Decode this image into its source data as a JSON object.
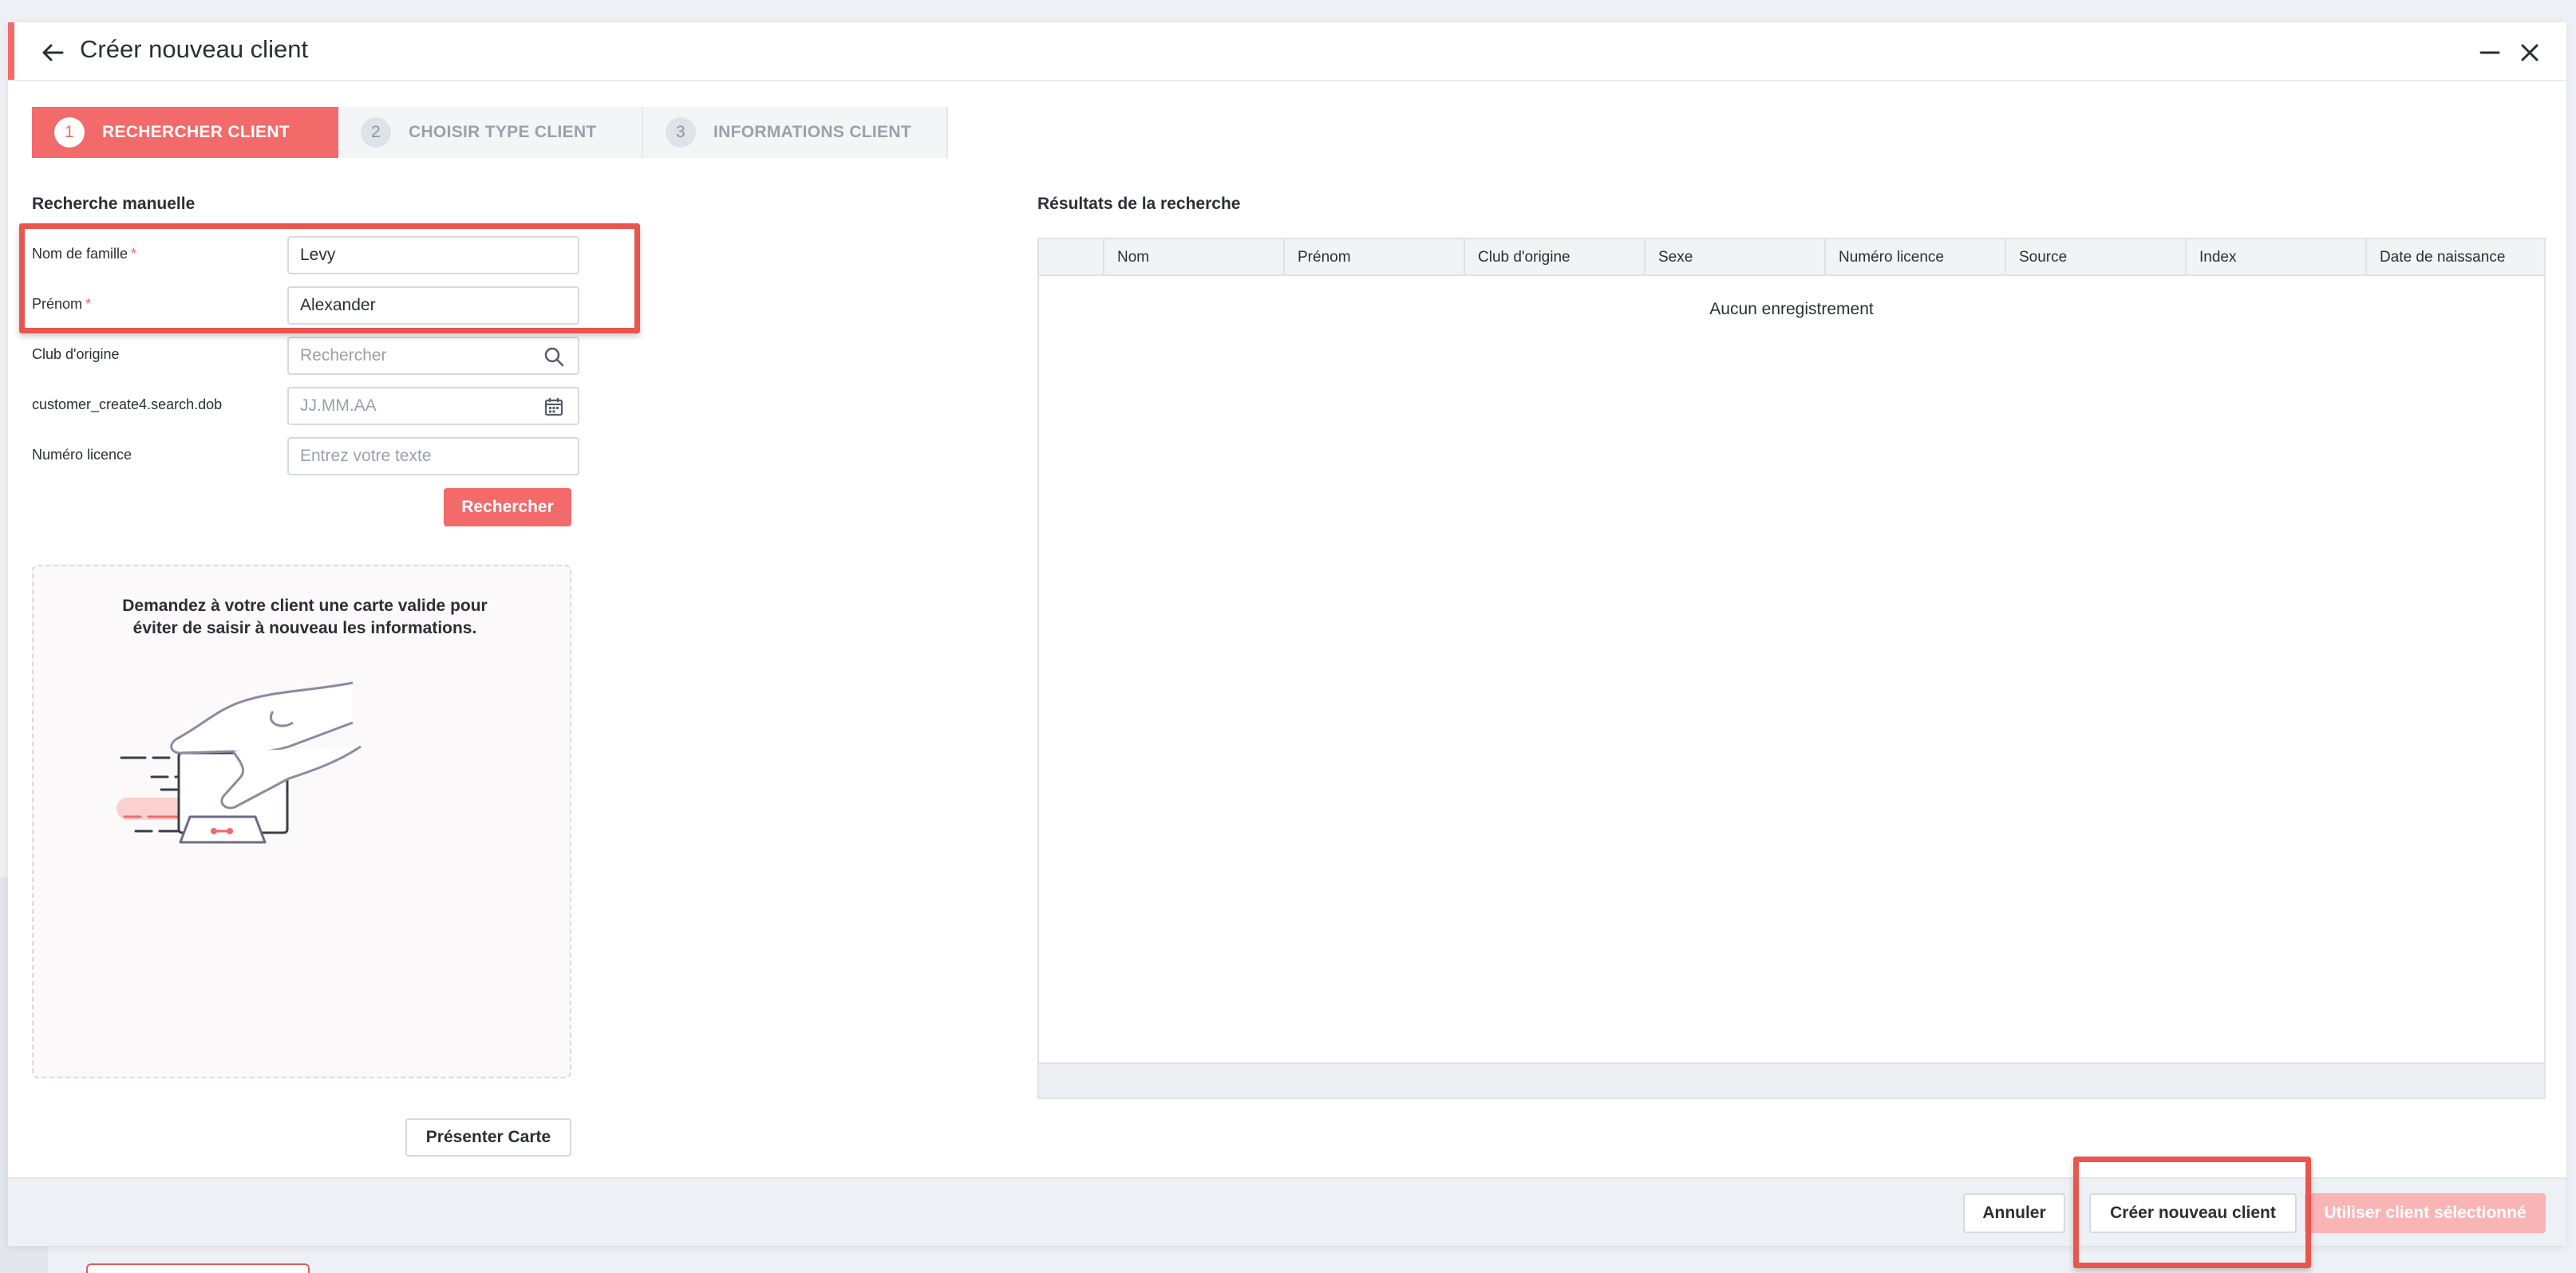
{
  "dialog": {
    "title": "Créer nouveau client"
  },
  "stepper": [
    {
      "num": "1",
      "label": "RECHERCHER CLIENT",
      "state": "active"
    },
    {
      "num": "2",
      "label": "CHOISIR TYPE CLIENT",
      "state": "inactive"
    },
    {
      "num": "3",
      "label": "INFORMATIONS CLIENT",
      "state": "inactive"
    }
  ],
  "search": {
    "section_title": "Recherche manuelle",
    "last_name_label": "Nom de famille",
    "last_name_value": "Levy",
    "first_name_label": "Prénom",
    "first_name_value": "Alexander",
    "club_label": "Club d'origine",
    "club_placeholder": "Rechercher",
    "dob_label": "customer_create4.search.dob",
    "dob_placeholder": "JJ.MM.AA",
    "license_label": "Numéro licence",
    "license_placeholder": "Entrez votre texte",
    "search_button": "Rechercher",
    "required_mark": "*"
  },
  "card": {
    "message": "Demandez à votre client une carte valide pour éviter de saisir à nouveau les informations.",
    "present_button": "Présenter Carte"
  },
  "results": {
    "section_title": "Résultats de la recherche",
    "columns": [
      "",
      "Nom",
      "Prénom",
      "Club d'origine",
      "Sexe",
      "Numéro licence",
      "Source",
      "Index",
      "Date de naissance"
    ],
    "empty_message": "Aucun enregistrement"
  },
  "footer": {
    "cancel_button": "Annuler",
    "create_button": "Créer nouveau client",
    "use_selected_button": "Utiliser client sélectionné"
  },
  "colors": {
    "accent": "#f26a6a",
    "highlight": "#e8564f",
    "disabled": "#f9b5b5"
  }
}
